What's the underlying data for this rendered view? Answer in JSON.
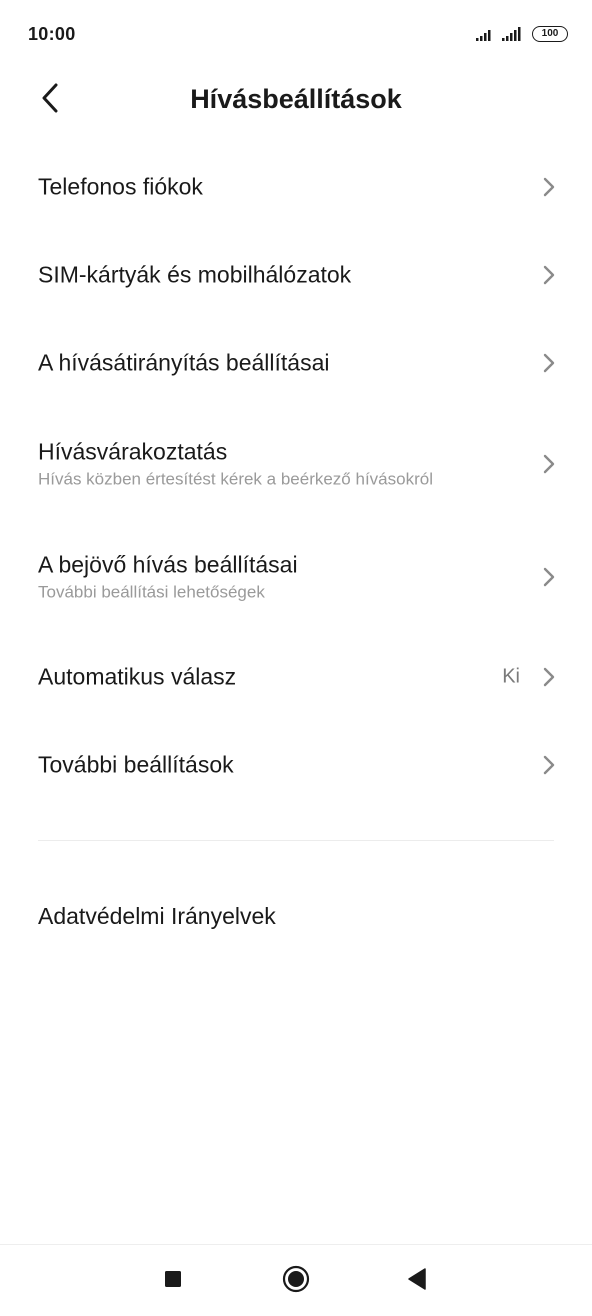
{
  "status_bar": {
    "time": "10:00",
    "battery": "100"
  },
  "header": {
    "title": "Hívásbeállítások"
  },
  "items": [
    {
      "title": "Telefonos fiókok"
    },
    {
      "title": "SIM-kártyák és mobilhálózatok"
    },
    {
      "title": "A hívásátirányítás beállításai"
    },
    {
      "title": "Hívásvárakoztatás",
      "subtitle": "Hívás közben értesítést kérek a beérkező hívásokról"
    },
    {
      "title": "A bejövő hívás beállításai",
      "subtitle": "További beállítási lehetőségek"
    },
    {
      "title": "Automatikus válasz",
      "value": "Ki"
    },
    {
      "title": "További beállítások"
    }
  ],
  "privacy": {
    "label": "Adatvédelmi Irányelvek"
  },
  "icons": {
    "back": "chevron-left-icon",
    "item_arrow": "chevron-right-icon",
    "nav_recents": "square-icon",
    "nav_home": "circle-icon",
    "nav_back": "triangle-left-icon"
  },
  "colors": {
    "text_primary": "#1a1a1a",
    "text_secondary": "#9a9a9a",
    "value": "#7a7a7a",
    "chevron": "#8a8a8a",
    "background": "#ffffff"
  }
}
